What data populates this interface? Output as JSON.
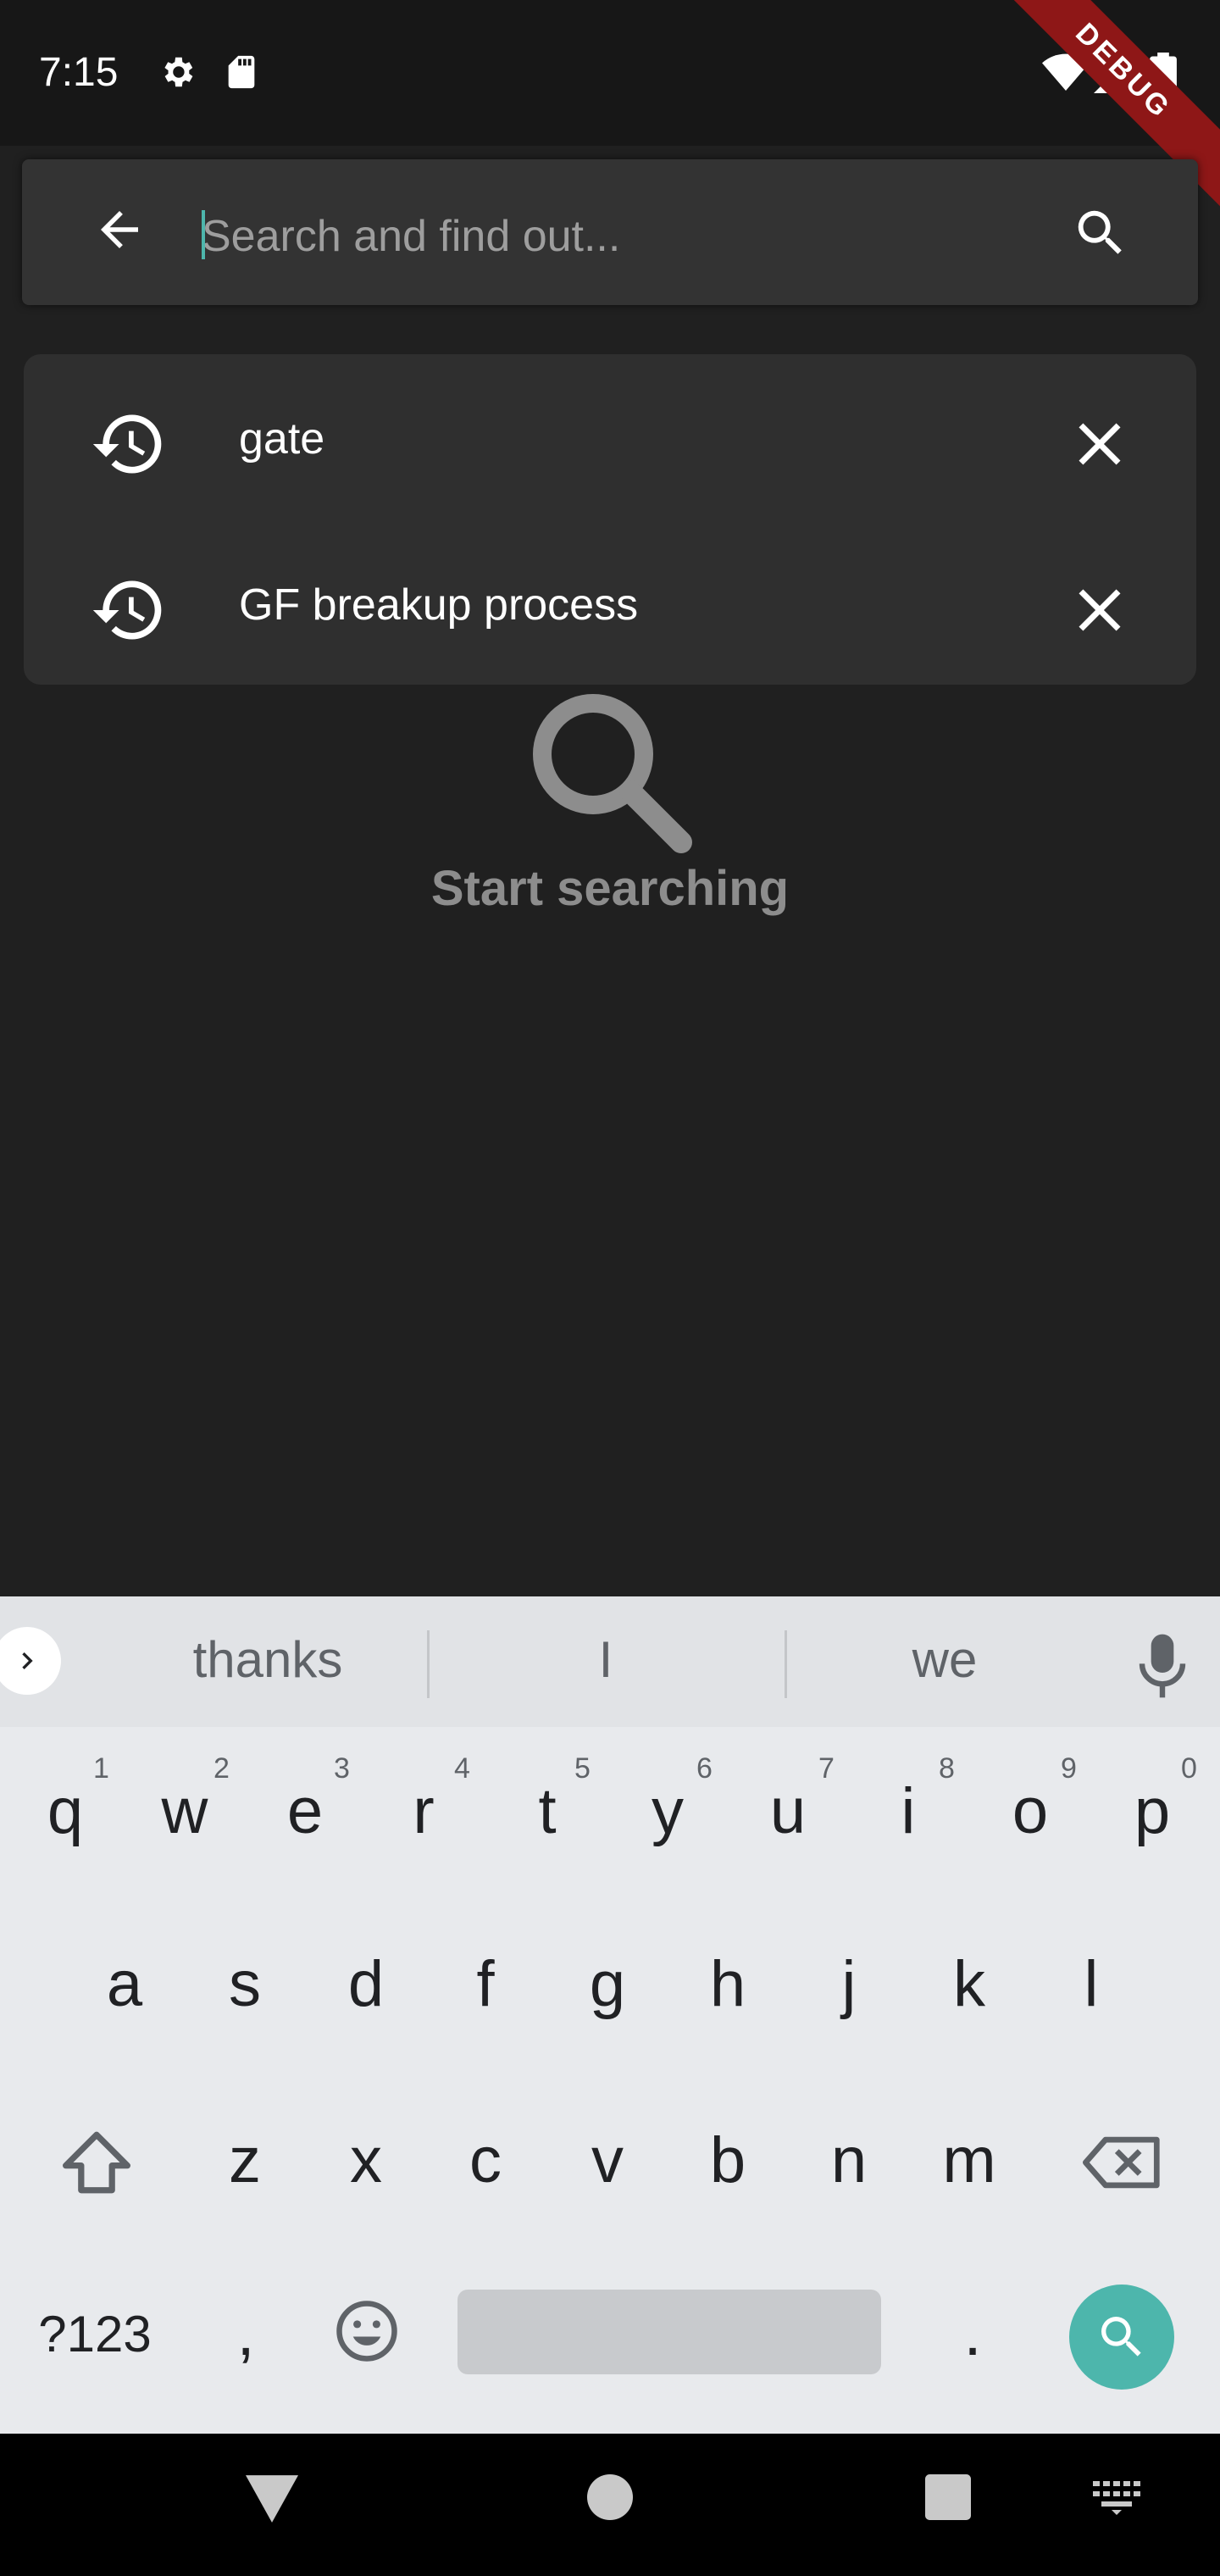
{
  "status_bar": {
    "time": "7:15",
    "debug_label": "DEBUG"
  },
  "search": {
    "placeholder": "Search and find out...",
    "value": ""
  },
  "history": [
    {
      "label": "gate"
    },
    {
      "label": "GF breakup process"
    }
  ],
  "empty_state": {
    "message": "Start searching"
  },
  "keyboard": {
    "suggestions": [
      "thanks",
      "I",
      "we"
    ],
    "row1": [
      "q",
      "w",
      "e",
      "r",
      "t",
      "y",
      "u",
      "i",
      "o",
      "p"
    ],
    "row1_hints": [
      "1",
      "2",
      "3",
      "4",
      "5",
      "6",
      "7",
      "8",
      "9",
      "0"
    ],
    "row2": [
      "a",
      "s",
      "d",
      "f",
      "g",
      "h",
      "j",
      "k",
      "l"
    ],
    "row3": [
      "z",
      "x",
      "c",
      "v",
      "b",
      "n",
      "m"
    ],
    "symbols_label": "?123",
    "comma": ",",
    "period": "."
  },
  "colors": {
    "accent": "#4db6ac",
    "background": "#202020",
    "debug": "#8e1717"
  }
}
